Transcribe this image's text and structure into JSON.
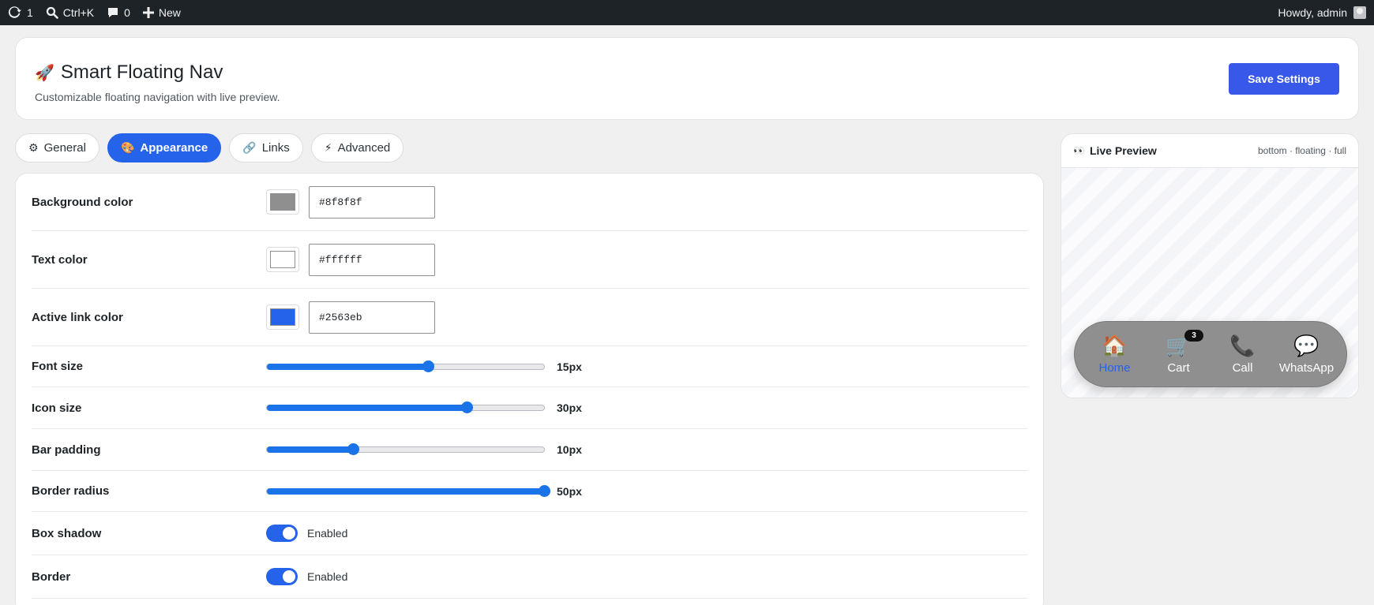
{
  "adminbar": {
    "updates_count": "1",
    "search_shortcut": "Ctrl+K",
    "comments_count": "0",
    "new_label": "New",
    "greeting": "Howdy, admin"
  },
  "header": {
    "icon": "🚀",
    "title": "Smart Floating Nav",
    "subtitle": "Customizable floating navigation with live preview.",
    "save_label": "Save Settings"
  },
  "tabs": [
    {
      "icon": "⚙",
      "label": "General",
      "active": false
    },
    {
      "icon": "🎨",
      "label": "Appearance",
      "active": true
    },
    {
      "icon": "🔗",
      "label": "Links",
      "active": false
    },
    {
      "icon": "⚡",
      "label": "Advanced",
      "active": false
    }
  ],
  "settings": {
    "background_color": {
      "label": "Background color",
      "value": "#8f8f8f"
    },
    "text_color": {
      "label": "Text color",
      "value": "#ffffff"
    },
    "active_link_color": {
      "label": "Active link color",
      "value": "#2563eb"
    },
    "font_size": {
      "label": "Font size",
      "value_text": "15px",
      "fraction": 0.58
    },
    "icon_size": {
      "label": "Icon size",
      "value_text": "30px",
      "fraction": 0.72
    },
    "bar_padding": {
      "label": "Bar padding",
      "value_text": "10px",
      "fraction": 0.31
    },
    "border_radius": {
      "label": "Border radius",
      "value_text": "50px",
      "fraction": 1.0
    },
    "box_shadow": {
      "label": "Box shadow",
      "state": "Enabled",
      "on": true
    },
    "border": {
      "label": "Border",
      "state": "Enabled",
      "on": true
    }
  },
  "preview": {
    "eyes_icon": "👀",
    "title": "Live Preview",
    "meta": "bottom · floating · full",
    "nav_items": [
      {
        "icon": "🏠",
        "label": "Home",
        "active": true,
        "badge": ""
      },
      {
        "icon": "🛒",
        "label": "Cart",
        "active": false,
        "badge": "3"
      },
      {
        "icon": "📞",
        "label": "Call",
        "active": false,
        "badge": ""
      },
      {
        "icon": "💬",
        "label": "WhatsApp",
        "active": false,
        "badge": ""
      }
    ]
  },
  "colors": {
    "accent": "#2563eb",
    "save_button": "#3858e9",
    "adminbar_bg": "#1d2327",
    "slider_fill": "#1a73e8"
  }
}
